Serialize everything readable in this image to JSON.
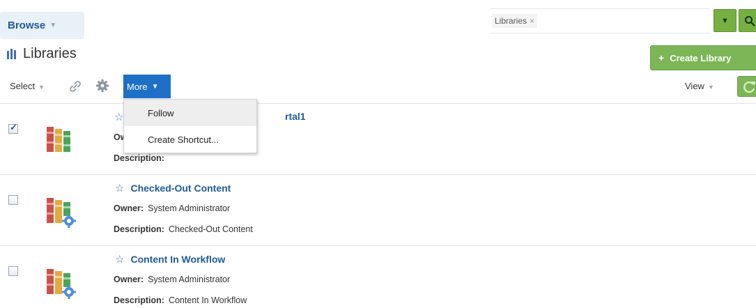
{
  "header": {
    "browse_label": "Browse",
    "search_token": "Libraries",
    "search_token_remove": "×"
  },
  "page": {
    "title": "Libraries",
    "create_button": "Create Library",
    "create_icon": "+"
  },
  "toolbar": {
    "select_label": "Select",
    "more_label": "More",
    "view_label": "View",
    "caret": "▼"
  },
  "menu": {
    "items": [
      {
        "label": "Follow"
      },
      {
        "label": "Create Shortcut..."
      }
    ]
  },
  "rows": [
    {
      "title": "rtal1",
      "owner_label": "Ow",
      "owner_value": "",
      "desc_label": "Description:",
      "desc_value": "",
      "checked": true
    },
    {
      "title": "Checked-Out Content",
      "owner_label": "Owner:",
      "owner_value": "System Administrator",
      "desc_label": "Description:",
      "desc_value": "Checked-Out Content",
      "checked": false
    },
    {
      "title": "Content In Workflow",
      "owner_label": "Owner:",
      "owner_value": "System Administrator",
      "desc_label": "Description:",
      "desc_value": "Content In Workflow",
      "checked": false
    }
  ],
  "colors": {
    "accent_blue": "#1e6fc6",
    "link_blue": "#1f5a96",
    "green": "#7cb657"
  },
  "icons": [
    "chevron-down-icon",
    "search-icon",
    "library-icon",
    "plus-icon",
    "link-icon",
    "gear-icon",
    "refresh-icon",
    "star-icon",
    "library-gear-icon"
  ]
}
